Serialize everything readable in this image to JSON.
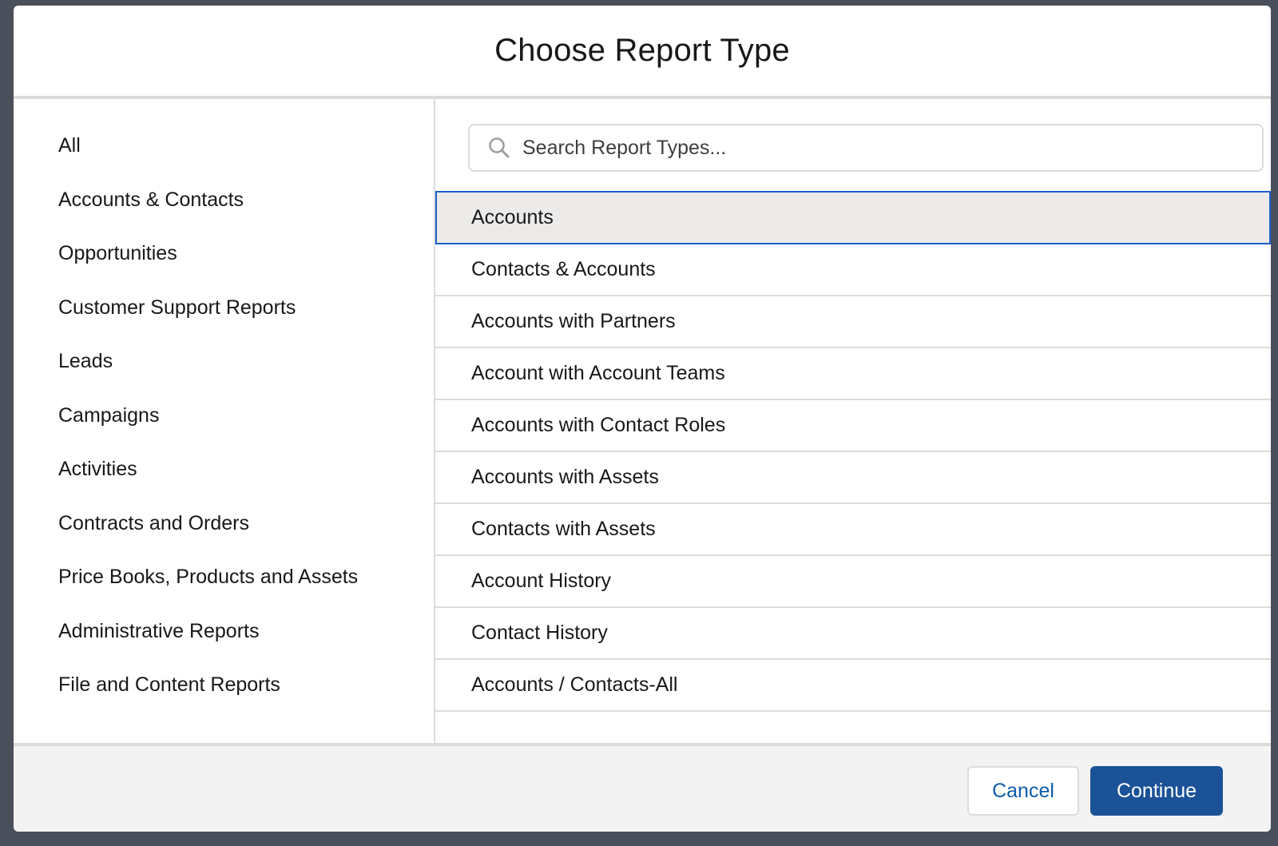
{
  "modal": {
    "title": "Choose Report Type"
  },
  "sidebar": {
    "items": [
      {
        "label": "All"
      },
      {
        "label": "Accounts & Contacts"
      },
      {
        "label": "Opportunities"
      },
      {
        "label": "Customer Support Reports"
      },
      {
        "label": "Leads"
      },
      {
        "label": "Campaigns"
      },
      {
        "label": "Activities"
      },
      {
        "label": "Contracts and Orders"
      },
      {
        "label": "Price Books, Products and Assets"
      },
      {
        "label": "Administrative Reports"
      },
      {
        "label": "File and Content Reports"
      }
    ]
  },
  "search": {
    "placeholder": "Search Report Types...",
    "value": "",
    "icon": "search-icon"
  },
  "report_types": {
    "selected_index": 0,
    "items": [
      {
        "label": "Accounts"
      },
      {
        "label": "Contacts & Accounts"
      },
      {
        "label": "Accounts with Partners"
      },
      {
        "label": "Account with Account Teams"
      },
      {
        "label": "Accounts with Contact Roles"
      },
      {
        "label": "Accounts with Assets"
      },
      {
        "label": "Contacts with Assets"
      },
      {
        "label": "Account History"
      },
      {
        "label": "Contact History"
      },
      {
        "label": "Accounts / Contacts-All"
      }
    ]
  },
  "footer": {
    "cancel_label": "Cancel",
    "continue_label": "Continue"
  },
  "colors": {
    "selected_border": "#1b5fcc",
    "selected_background": "#ecebea",
    "primary_button": "#1b5297",
    "link_text": "#0b5cab",
    "backdrop": "#4a505b"
  }
}
